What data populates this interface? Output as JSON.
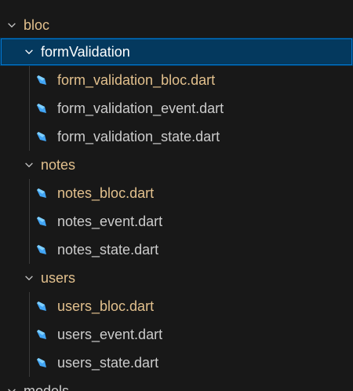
{
  "theme": {
    "background": "#181818",
    "selected_bg": "#04395e",
    "selected_border": "#0078d4",
    "modified_color": "#e2c08d",
    "file_color": "#cccccc",
    "dart_icon_color": "#42a5f5"
  },
  "tree": {
    "bloc": {
      "label": "bloc",
      "icon": "chevron-down-icon",
      "expanded": true
    },
    "formValidation": {
      "label": "formValidation",
      "icon": "chevron-down-icon",
      "expanded": true,
      "selected": true,
      "files": [
        {
          "label": "form_validation_bloc.dart",
          "icon": "dart-icon",
          "modified": true
        },
        {
          "label": "form_validation_event.dart",
          "icon": "dart-icon",
          "modified": false
        },
        {
          "label": "form_validation_state.dart",
          "icon": "dart-icon",
          "modified": false
        }
      ]
    },
    "notes": {
      "label": "notes",
      "icon": "chevron-down-icon",
      "expanded": true,
      "files": [
        {
          "label": "notes_bloc.dart",
          "icon": "dart-icon",
          "modified": true
        },
        {
          "label": "notes_event.dart",
          "icon": "dart-icon",
          "modified": false
        },
        {
          "label": "notes_state.dart",
          "icon": "dart-icon",
          "modified": false
        }
      ]
    },
    "users": {
      "label": "users",
      "icon": "chevron-down-icon",
      "expanded": true,
      "files": [
        {
          "label": "users_bloc.dart",
          "icon": "dart-icon",
          "modified": true
        },
        {
          "label": "users_event.dart",
          "icon": "dart-icon",
          "modified": false
        },
        {
          "label": "users_state.dart",
          "icon": "dart-icon",
          "modified": false
        }
      ]
    },
    "models": {
      "label": "models",
      "icon": "chevron-down-icon",
      "expanded": true
    }
  }
}
